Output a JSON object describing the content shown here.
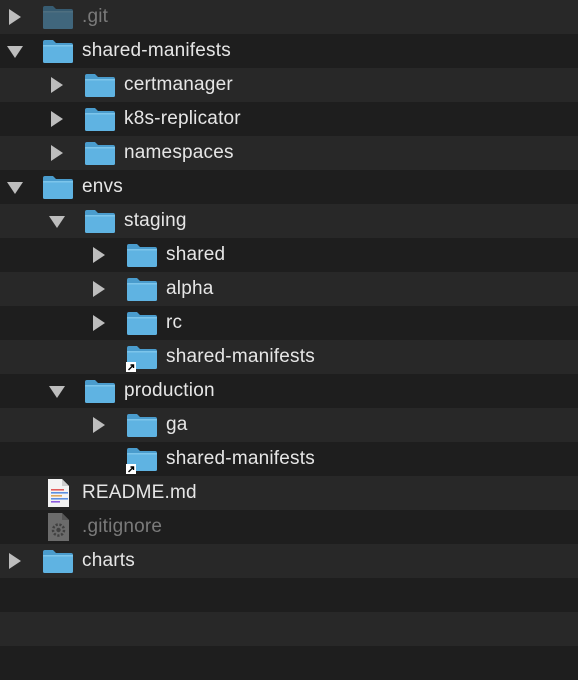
{
  "items": [
    {
      "label": ".git",
      "depth": 0,
      "kind": "folder",
      "state": "collapsed",
      "dim": true
    },
    {
      "label": "shared-manifests",
      "depth": 0,
      "kind": "folder",
      "state": "expanded"
    },
    {
      "label": "certmanager",
      "depth": 1,
      "kind": "folder",
      "state": "collapsed"
    },
    {
      "label": "k8s-replicator",
      "depth": 1,
      "kind": "folder",
      "state": "collapsed"
    },
    {
      "label": "namespaces",
      "depth": 1,
      "kind": "folder",
      "state": "collapsed"
    },
    {
      "label": "envs",
      "depth": 0,
      "kind": "folder",
      "state": "expanded"
    },
    {
      "label": "staging",
      "depth": 1,
      "kind": "folder",
      "state": "expanded"
    },
    {
      "label": "shared",
      "depth": 2,
      "kind": "folder",
      "state": "collapsed"
    },
    {
      "label": "alpha",
      "depth": 2,
      "kind": "folder",
      "state": "collapsed"
    },
    {
      "label": "rc",
      "depth": 2,
      "kind": "folder",
      "state": "collapsed"
    },
    {
      "label": "shared-manifests",
      "depth": 2,
      "kind": "alias",
      "state": "none"
    },
    {
      "label": "production",
      "depth": 1,
      "kind": "folder",
      "state": "expanded"
    },
    {
      "label": "ga",
      "depth": 2,
      "kind": "folder",
      "state": "collapsed"
    },
    {
      "label": "shared-manifests",
      "depth": 2,
      "kind": "alias",
      "state": "none"
    },
    {
      "label": "README.md",
      "depth": 0,
      "kind": "doc",
      "state": "none"
    },
    {
      "label": ".gitignore",
      "depth": 0,
      "kind": "config",
      "state": "none",
      "dim": true
    },
    {
      "label": "charts",
      "depth": 0,
      "kind": "folder",
      "state": "collapsed"
    }
  ],
  "colors": {
    "folder_body": "#5fb3e2",
    "folder_tab": "#4a9ccd",
    "triangle": "#bdbdbd",
    "text": "#e6e6e6",
    "dim_text": "#7a7a7a",
    "row_even": "#1e1e1e",
    "row_odd": "#282828"
  }
}
